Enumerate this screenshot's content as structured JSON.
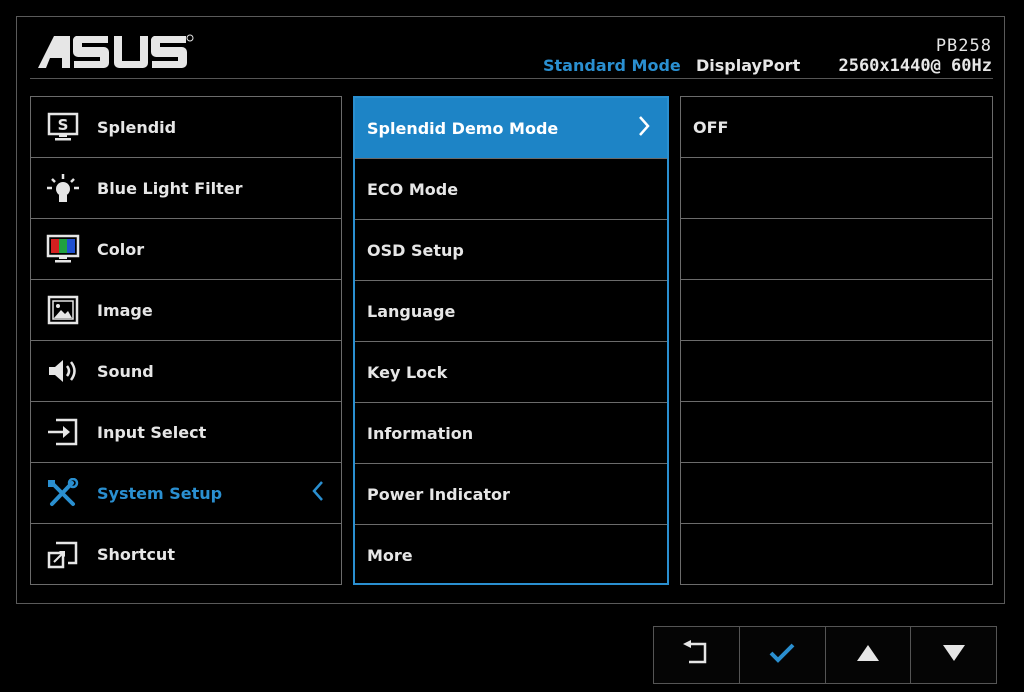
{
  "header": {
    "brand": "ASUS",
    "model": "PB258",
    "mode": "Standard Mode",
    "input": "DisplayPort",
    "resolution": "2560x1440@ 60Hz"
  },
  "menu": {
    "items": [
      {
        "label": "Splendid",
        "icon": "splendid-icon"
      },
      {
        "label": "Blue Light Filter",
        "icon": "blue-light-icon"
      },
      {
        "label": "Color",
        "icon": "color-icon"
      },
      {
        "label": "Image",
        "icon": "image-icon"
      },
      {
        "label": "Sound",
        "icon": "sound-icon"
      },
      {
        "label": "Input Select",
        "icon": "input-select-icon"
      },
      {
        "label": "System Setup",
        "icon": "system-setup-icon"
      },
      {
        "label": "Shortcut",
        "icon": "shortcut-icon"
      }
    ],
    "active_index": 6
  },
  "submenu": {
    "items": [
      "Splendid Demo Mode",
      "ECO Mode",
      "OSD Setup",
      "Language",
      "Key Lock",
      "Information",
      "Power Indicator",
      "More"
    ],
    "selected_index": 0
  },
  "values": {
    "items": [
      "OFF",
      "",
      "",
      "",
      "",
      "",
      "",
      ""
    ]
  },
  "nav": {
    "buttons": [
      "back-icon",
      "check-icon",
      "up-arrow-icon",
      "down-arrow-icon"
    ]
  },
  "colors": {
    "accent": "#1d84c6",
    "accent_text": "#2a8fd0",
    "border": "#6b6b6b",
    "background": "#000000"
  }
}
